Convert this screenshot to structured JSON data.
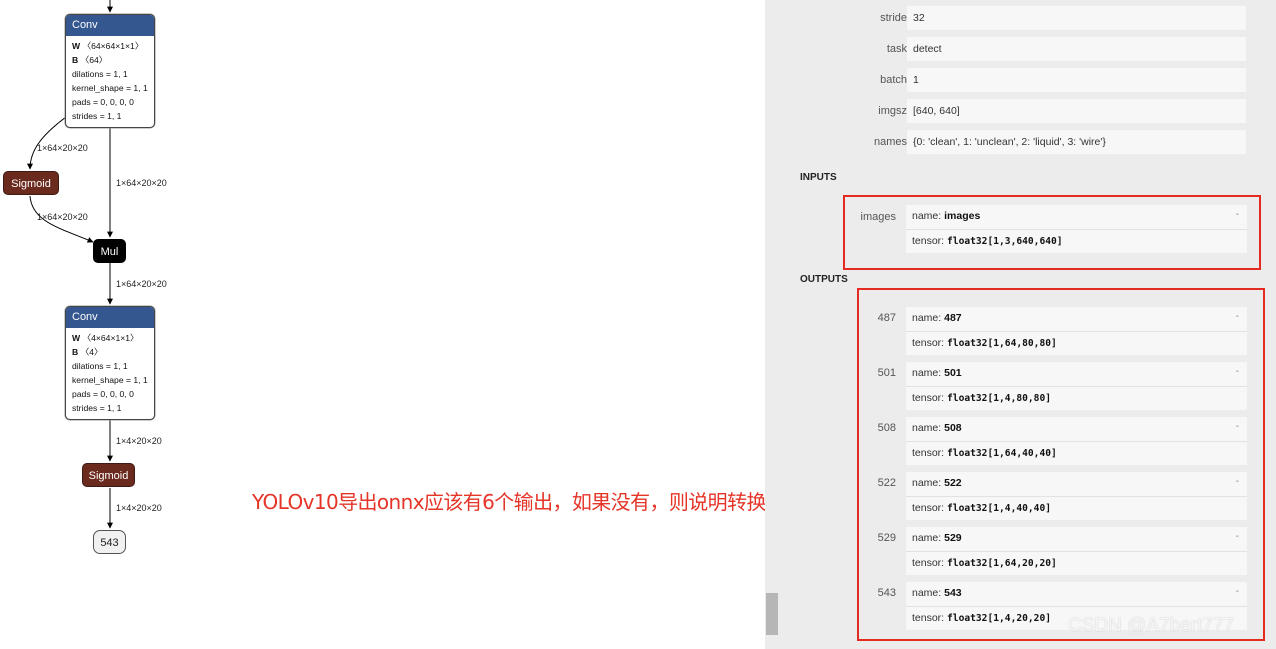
{
  "graph": {
    "conv1": {
      "title": "Conv",
      "attrs": [
        "W〈64×64×1×1〉",
        "B〈64〉",
        "dilations = 1, 1",
        "kernel_shape = 1, 1",
        "pads = 0, 0, 0, 0",
        "strides = 1, 1"
      ]
    },
    "sigmoid1": "Sigmoid",
    "mul": "Mul",
    "conv2": {
      "title": "Conv",
      "attrs": [
        "W〈4×64×1×1〉",
        "B〈4〉",
        "dilations = 1, 1",
        "kernel_shape = 1, 1",
        "pads = 0, 0, 0, 0",
        "strides = 1, 1"
      ]
    },
    "sigmoid2": "Sigmoid",
    "output_node": "543",
    "edge_labels": {
      "conv1_to_sigmoid": "1×64×20×20",
      "conv1_to_mul": "1×64×20×20",
      "sigmoid_to_mul": "1×64×20×20",
      "mul_to_conv2": "1×64×20×20",
      "conv2_to_sigmoid": "1×4×20×20",
      "sigmoid_to_output": "1×4×20×20"
    }
  },
  "annotation": "YOLOv10导出onnx应该有6个输出，如果没有，则说明转换失败",
  "sidebar": {
    "metadata": [
      {
        "label": "stride",
        "value": "32"
      },
      {
        "label": "task",
        "value": "detect"
      },
      {
        "label": "batch",
        "value": "1"
      },
      {
        "label": "imgsz",
        "value": "[640, 640]"
      },
      {
        "label": "names",
        "value": "{0: 'clean', 1: 'unclean', 2: 'liquid', 3: 'wire'}"
      }
    ],
    "inputs_title": "INPUTS",
    "inputs": [
      {
        "label": "images",
        "name_prefix": "name: ",
        "name": "images",
        "tensor_prefix": "tensor: ",
        "tensor": "float32[1,3,640,640]",
        "dash": "-"
      }
    ],
    "outputs_title": "OUTPUTS",
    "outputs": [
      {
        "label": "487",
        "name_prefix": "name: ",
        "name": "487",
        "tensor_prefix": "tensor: ",
        "tensor": "float32[1,64,80,80]",
        "dash": "-"
      },
      {
        "label": "501",
        "name_prefix": "name: ",
        "name": "501",
        "tensor_prefix": "tensor: ",
        "tensor": "float32[1,4,80,80]",
        "dash": "-"
      },
      {
        "label": "508",
        "name_prefix": "name: ",
        "name": "508",
        "tensor_prefix": "tensor: ",
        "tensor": "float32[1,64,40,40]",
        "dash": "-"
      },
      {
        "label": "522",
        "name_prefix": "name: ",
        "name": "522",
        "tensor_prefix": "tensor: ",
        "tensor": "float32[1,4,40,40]",
        "dash": "-"
      },
      {
        "label": "529",
        "name_prefix": "name: ",
        "name": "529",
        "tensor_prefix": "tensor: ",
        "tensor": "float32[1,64,20,20]",
        "dash": "-"
      },
      {
        "label": "543",
        "name_prefix": "name: ",
        "name": "543",
        "tensor_prefix": "tensor: ",
        "tensor": "float32[1,4,20,20]",
        "dash": "-"
      }
    ]
  },
  "watermark": "CSDN @A7bert777",
  "colors": {
    "conv_header": "#34578f",
    "sigmoid": "#6b2a1e",
    "mul": "#000000",
    "highlight_box": "#e32b21",
    "annotation": "#e53428"
  }
}
